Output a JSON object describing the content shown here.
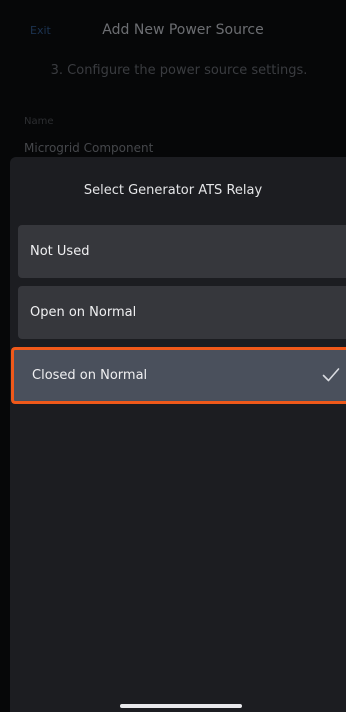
{
  "header": {
    "exit_label": "Exit",
    "title": "Add New Power Source"
  },
  "step": {
    "text": "3. Configure the power source settings."
  },
  "name_field": {
    "label": "Name",
    "value": "Microgrid Component"
  },
  "sheet": {
    "title": "Select Generator ATS Relay",
    "options": [
      {
        "label": "Not Used",
        "selected": false
      },
      {
        "label": "Open on Normal",
        "selected": false
      },
      {
        "label": "Closed on Normal",
        "selected": true
      }
    ],
    "selected_icon": "checkmark-icon"
  },
  "colors": {
    "highlight": "#f0591a",
    "selected_bg": "#4a505c",
    "option_bg": "#36373c",
    "sheet_bg": "#1c1d21"
  }
}
